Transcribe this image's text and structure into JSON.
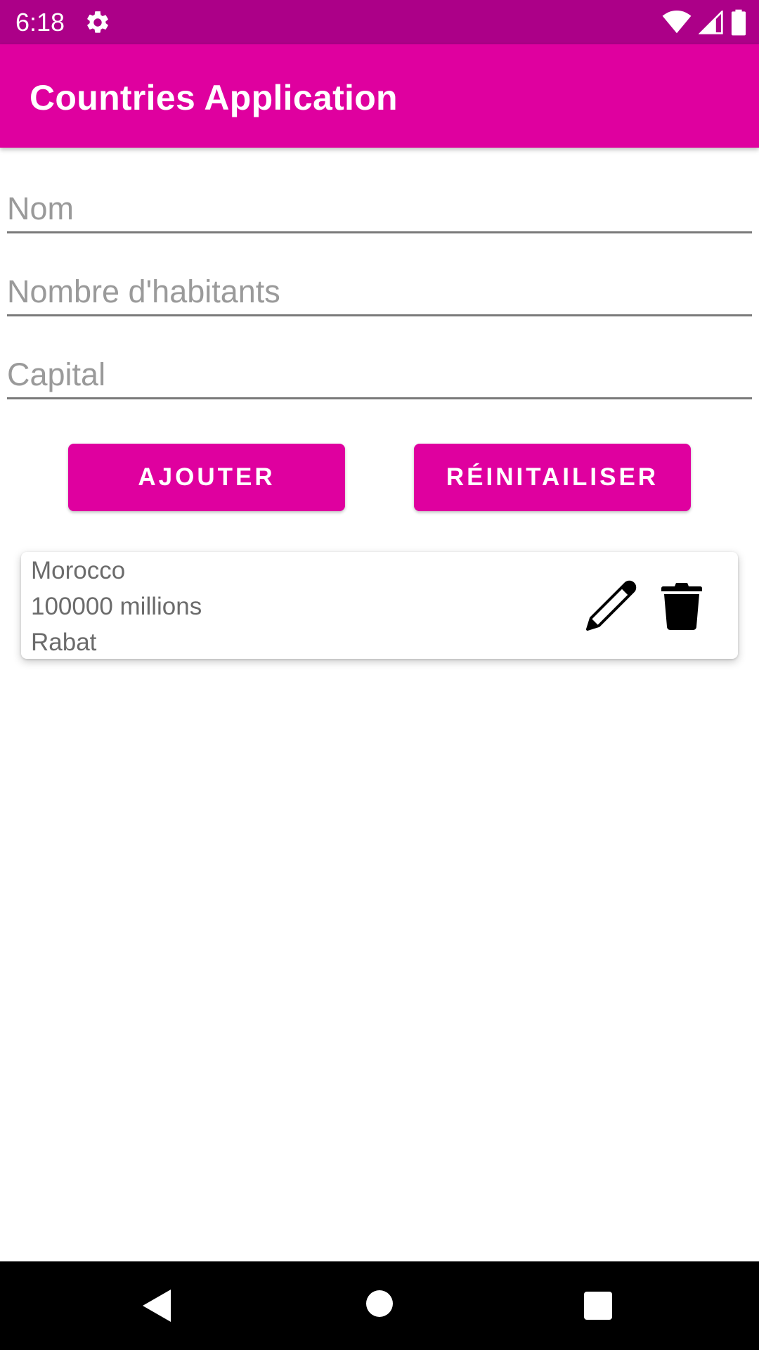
{
  "status_bar": {
    "time": "6:18",
    "icons": [
      "settings-icon",
      "wifi-icon",
      "cell-signal-icon",
      "battery-icon"
    ],
    "background": "#ac0088"
  },
  "app_bar": {
    "title": "Countries Application",
    "background": "#df009f"
  },
  "form": {
    "name_placeholder": "Nom",
    "population_placeholder": "Nombre d'habitants",
    "capital_placeholder": "Capital",
    "add_label": "AJOUTER",
    "reset_label": "RÉINITAILISER"
  },
  "countries": [
    {
      "name": "Morocco",
      "population": "100000 millions",
      "capital": "Rabat",
      "actions": [
        "edit-icon",
        "delete-icon"
      ]
    }
  ],
  "nav_bar": {
    "buttons": [
      "back-icon",
      "home-icon",
      "recents-icon"
    ]
  },
  "colors": {
    "accent": "#df009f",
    "status": "#ac0088"
  }
}
